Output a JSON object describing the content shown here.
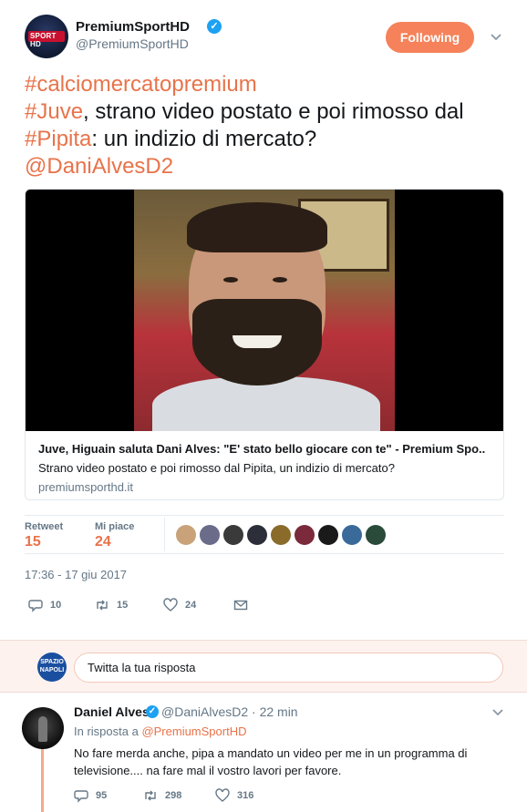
{
  "header": {
    "display_name": "PremiumSportHD",
    "handle": "@PremiumSportHD",
    "follow_label": "Following",
    "avatar_logo_text": "SPORT HD"
  },
  "tweet": {
    "line1_tag": "#calciomercatopremium",
    "line2_tag": "#Juve",
    "line2_text": ", strano video postato e poi rimosso dal",
    "line3_tag": "#Pipita",
    "line3_text": ": un indizio di mercato?",
    "line4_mention": "@DaniAlvesD2"
  },
  "card": {
    "title": "Juve, Higuain saluta Dani Alves: \"E' stato bello giocare con te\" - Premium Spo..",
    "description": "Strano video postato e poi rimosso dal Pipita, un indizio di mercato?",
    "domain": "premiumsporthd.it"
  },
  "stats": {
    "retweet_label": "Retweet",
    "retweet_count": "15",
    "likes_label": "Mi piace",
    "likes_count": "24",
    "liker_colors": [
      "#c9a27a",
      "#6b6b8a",
      "#3a3a3a",
      "#2c2f3a",
      "#8a6b2a",
      "#7a2a3a",
      "#1a1a1a",
      "#3a6a9a",
      "#2a4a3a"
    ]
  },
  "timestamp": "17:36 - 17 giu 2017",
  "actions": {
    "reply_count": "10",
    "retweet_count": "15",
    "like_count": "24"
  },
  "composer": {
    "placeholder": "Twitta la tua risposta",
    "avatar_line1": "SPAZIO",
    "avatar_line2": "NAPOLI"
  },
  "reply": {
    "name": "Daniel Alves",
    "handle_time": "@DaniAlvesD2 · 22 min",
    "in_reply_prefix": "In risposta a ",
    "in_reply_mention": "@PremiumSportHD",
    "text": "No fare merda anche, pipa a mandato un video per me in un programma di televisione....  na fare mal il vostro lavori per favore.",
    "reply_count": "95",
    "retweet_count": "298",
    "like_count": "316"
  },
  "colors": {
    "accent": "#e8734a",
    "follow_button": "#f5825a",
    "verified": "#1da1f2"
  }
}
